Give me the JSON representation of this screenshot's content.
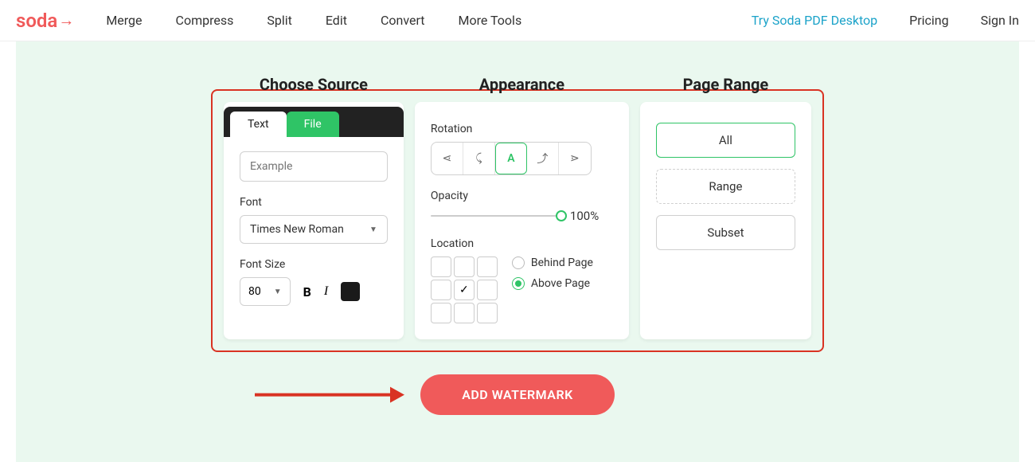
{
  "brand": "soda",
  "nav": {
    "items": [
      "Merge",
      "Compress",
      "Split",
      "Edit",
      "Convert",
      "More Tools"
    ],
    "cta": "Try Soda PDF Desktop",
    "pricing": "Pricing",
    "signin": "Sign In"
  },
  "panels": {
    "source": {
      "title": "Choose Source",
      "tab_text": "Text",
      "tab_file": "File",
      "input_placeholder": "Example",
      "font_label": "Font",
      "font_value": "Times New Roman",
      "fontsize_label": "Font Size",
      "fontsize_value": "80",
      "bold": "B",
      "italic": "I",
      "color": "#1a1a1a"
    },
    "appearance": {
      "title": "Appearance",
      "rotation_label": "Rotation",
      "rotation_selected": "A",
      "opacity_label": "Opacity",
      "opacity_value": "100%",
      "location_label": "Location",
      "location_selected_index": 4,
      "radio_behind": "Behind Page",
      "radio_above": "Above Page",
      "radio_selected": "above"
    },
    "range": {
      "title": "Page Range",
      "all": "All",
      "range": "Range",
      "subset": "Subset",
      "selected": "all"
    }
  },
  "cta_label": "ADD WATERMARK"
}
